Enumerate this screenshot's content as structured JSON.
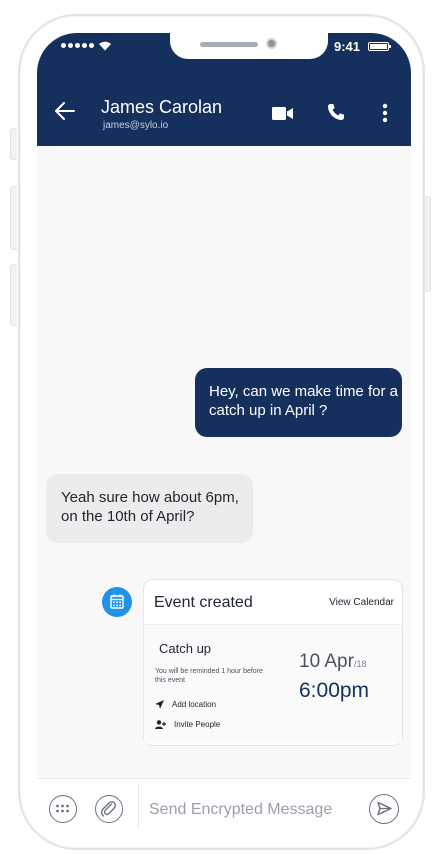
{
  "status_bar": {
    "time": "9:41"
  },
  "header": {
    "contact_name": "James Carolan",
    "contact_email": "james@sylo.io"
  },
  "messages": [
    {
      "direction": "outgoing",
      "text": "Hey, can we make time for a catch up in April ?"
    },
    {
      "direction": "incoming",
      "text": "Yeah sure how about 6pm, on the 10th of April?"
    }
  ],
  "event_card": {
    "title": "Event created",
    "view_calendar_label": "View Calendar",
    "event_name": "Catch up",
    "reminder_text": "You will be reminded 1 hour before this event",
    "add_location_label": "Add location",
    "invite_people_label": "Invite People",
    "date": "10 Apr",
    "year": "/18",
    "time": "6:00pm"
  },
  "composer": {
    "placeholder": "Send Encrypted Message"
  },
  "colors": {
    "header": "#15305c",
    "outgoing_bubble": "#15305c",
    "incoming_bubble": "#ececec",
    "calendar_badge": "#1e93e8"
  }
}
